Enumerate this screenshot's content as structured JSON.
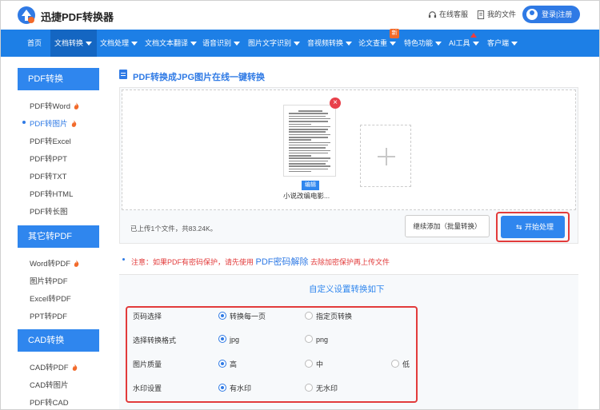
{
  "header": {
    "brand": "迅捷PDF转换器",
    "support_label": "在线客服",
    "my_files_label": "我的文件",
    "login_label": "登录|注册"
  },
  "nav": {
    "items": [
      {
        "label": "首页",
        "caret": false
      },
      {
        "label": "文档转换",
        "caret": true,
        "active": true
      },
      {
        "label": "文档处理",
        "caret": true
      },
      {
        "label": "文档文本翻译",
        "caret": true
      },
      {
        "label": "语音识别",
        "caret": true
      },
      {
        "label": "图片文字识别",
        "caret": true
      },
      {
        "label": "音视频转换",
        "caret": true
      },
      {
        "label": "论文查重",
        "caret": true
      },
      {
        "label": "特色功能",
        "caret": true
      },
      {
        "label": "AI工具",
        "caret": true
      },
      {
        "label": "客户端",
        "caret": true
      }
    ],
    "new_badge": "新"
  },
  "sidebar": {
    "sections": [
      {
        "title": "PDF转换",
        "items": [
          "PDF转Word",
          "PDF转图片",
          "PDF转Excel",
          "PDF转PPT",
          "PDF转TXT",
          "PDF转HTML",
          "PDF转长图"
        ]
      },
      {
        "title": "其它转PDF",
        "items": [
          "Word转PDF",
          "图片转PDF",
          "Excel转PDF",
          "PPT转PDF"
        ]
      },
      {
        "title": "CAD转换",
        "items": [
          "CAD转PDF",
          "CAD转图片",
          "PDF转CAD"
        ]
      }
    ],
    "active_item": "PDF转图片"
  },
  "main": {
    "page_title": "PDF转换成JPG图片在线一键转换",
    "file": {
      "edit_label": "编辑",
      "name": "小说改编电影..."
    },
    "upload_info": "已上传1个文件，共83.24K。",
    "continue_button": "继续添加（批量转换）",
    "start_button": "开始处理",
    "notice": {
      "prefix": "注意：如果PDF有密码保护，请先使用",
      "link": "PDF密码解除",
      "suffix": "去除加密保护再上传文件"
    },
    "settings_title": "自定义设置转换如下",
    "settings": [
      {
        "label": "页码选择",
        "options": [
          "转换每一页",
          "指定页转换"
        ],
        "selected": "转换每一页"
      },
      {
        "label": "选择转换格式",
        "options": [
          "jpg",
          "png"
        ],
        "selected": "jpg"
      },
      {
        "label": "图片质量",
        "options": [
          "高",
          "中",
          "低"
        ],
        "selected": "高"
      },
      {
        "label": "水印设置",
        "options": [
          "有水印",
          "无水印"
        ],
        "selected": "有水印"
      }
    ]
  },
  "colors": {
    "primary": "#2f86ee",
    "nav": "#1d7fe6",
    "highlight_border": "#e23b3b"
  }
}
